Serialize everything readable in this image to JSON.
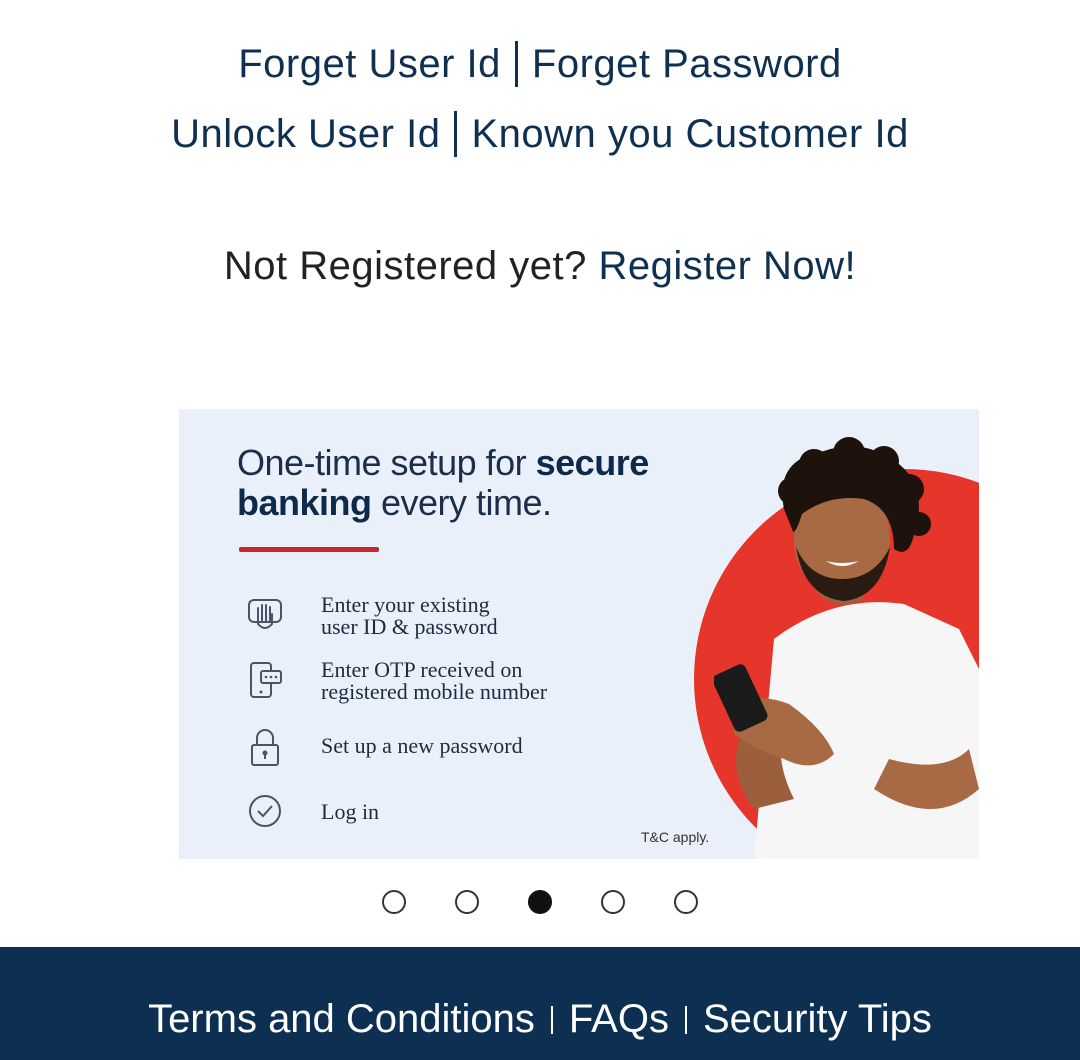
{
  "links": {
    "forget_user_id": "Forget User Id",
    "forget_password": "Forget Password",
    "unlock_user_id": "Unlock User Id",
    "known_customer_id": "Known you Customer Id"
  },
  "register": {
    "prompt": "Not Registered yet?",
    "link": "Register Now!"
  },
  "banner": {
    "headline_part1": "One-time setup for ",
    "headline_bold1": "secure",
    "headline_bold2": "banking",
    "headline_part2": " every time.",
    "steps": [
      {
        "line1": "Enter your existing",
        "line2": "user ID & password",
        "icon": "hand-icon"
      },
      {
        "line1": "Enter OTP received on",
        "line2": "registered mobile number",
        "icon": "mobile-otp-icon"
      },
      {
        "line1": "Set up a new password",
        "line2": "",
        "icon": "lock-icon"
      },
      {
        "line1": "Log in",
        "line2": "",
        "icon": "check-circle-icon"
      }
    ],
    "tc": "T&C apply."
  },
  "carousel": {
    "total": 5,
    "active_index": 2
  },
  "footer": {
    "terms": "Terms and Conditions",
    "faqs": "FAQs",
    "security": "Security Tips"
  },
  "colors": {
    "navy": "#0d2f52",
    "accent_red": "#c6252c",
    "banner_bg": "#e9f0fa"
  }
}
